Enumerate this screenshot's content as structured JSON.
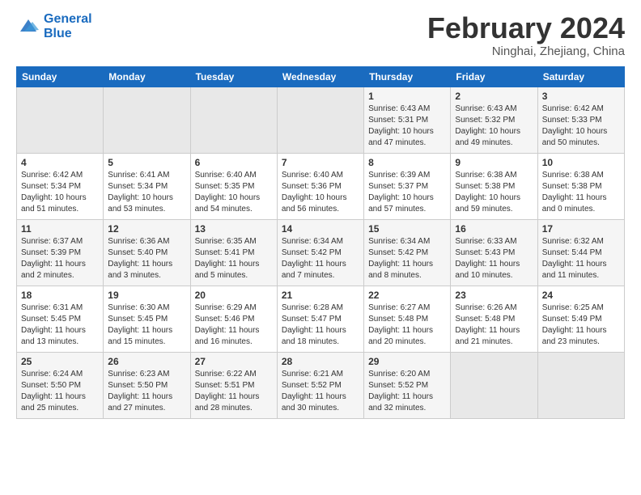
{
  "header": {
    "logo_line1": "General",
    "logo_line2": "Blue",
    "month": "February 2024",
    "location": "Ninghai, Zhejiang, China"
  },
  "weekdays": [
    "Sunday",
    "Monday",
    "Tuesday",
    "Wednesday",
    "Thursday",
    "Friday",
    "Saturday"
  ],
  "weeks": [
    [
      {
        "day": "",
        "info": ""
      },
      {
        "day": "",
        "info": ""
      },
      {
        "day": "",
        "info": ""
      },
      {
        "day": "",
        "info": ""
      },
      {
        "day": "1",
        "info": "Sunrise: 6:43 AM\nSunset: 5:31 PM\nDaylight: 10 hours\nand 47 minutes."
      },
      {
        "day": "2",
        "info": "Sunrise: 6:43 AM\nSunset: 5:32 PM\nDaylight: 10 hours\nand 49 minutes."
      },
      {
        "day": "3",
        "info": "Sunrise: 6:42 AM\nSunset: 5:33 PM\nDaylight: 10 hours\nand 50 minutes."
      }
    ],
    [
      {
        "day": "4",
        "info": "Sunrise: 6:42 AM\nSunset: 5:34 PM\nDaylight: 10 hours\nand 51 minutes."
      },
      {
        "day": "5",
        "info": "Sunrise: 6:41 AM\nSunset: 5:34 PM\nDaylight: 10 hours\nand 53 minutes."
      },
      {
        "day": "6",
        "info": "Sunrise: 6:40 AM\nSunset: 5:35 PM\nDaylight: 10 hours\nand 54 minutes."
      },
      {
        "day": "7",
        "info": "Sunrise: 6:40 AM\nSunset: 5:36 PM\nDaylight: 10 hours\nand 56 minutes."
      },
      {
        "day": "8",
        "info": "Sunrise: 6:39 AM\nSunset: 5:37 PM\nDaylight: 10 hours\nand 57 minutes."
      },
      {
        "day": "9",
        "info": "Sunrise: 6:38 AM\nSunset: 5:38 PM\nDaylight: 10 hours\nand 59 minutes."
      },
      {
        "day": "10",
        "info": "Sunrise: 6:38 AM\nSunset: 5:38 PM\nDaylight: 11 hours\nand 0 minutes."
      }
    ],
    [
      {
        "day": "11",
        "info": "Sunrise: 6:37 AM\nSunset: 5:39 PM\nDaylight: 11 hours\nand 2 minutes."
      },
      {
        "day": "12",
        "info": "Sunrise: 6:36 AM\nSunset: 5:40 PM\nDaylight: 11 hours\nand 3 minutes."
      },
      {
        "day": "13",
        "info": "Sunrise: 6:35 AM\nSunset: 5:41 PM\nDaylight: 11 hours\nand 5 minutes."
      },
      {
        "day": "14",
        "info": "Sunrise: 6:34 AM\nSunset: 5:42 PM\nDaylight: 11 hours\nand 7 minutes."
      },
      {
        "day": "15",
        "info": "Sunrise: 6:34 AM\nSunset: 5:42 PM\nDaylight: 11 hours\nand 8 minutes."
      },
      {
        "day": "16",
        "info": "Sunrise: 6:33 AM\nSunset: 5:43 PM\nDaylight: 11 hours\nand 10 minutes."
      },
      {
        "day": "17",
        "info": "Sunrise: 6:32 AM\nSunset: 5:44 PM\nDaylight: 11 hours\nand 11 minutes."
      }
    ],
    [
      {
        "day": "18",
        "info": "Sunrise: 6:31 AM\nSunset: 5:45 PM\nDaylight: 11 hours\nand 13 minutes."
      },
      {
        "day": "19",
        "info": "Sunrise: 6:30 AM\nSunset: 5:45 PM\nDaylight: 11 hours\nand 15 minutes."
      },
      {
        "day": "20",
        "info": "Sunrise: 6:29 AM\nSunset: 5:46 PM\nDaylight: 11 hours\nand 16 minutes."
      },
      {
        "day": "21",
        "info": "Sunrise: 6:28 AM\nSunset: 5:47 PM\nDaylight: 11 hours\nand 18 minutes."
      },
      {
        "day": "22",
        "info": "Sunrise: 6:27 AM\nSunset: 5:48 PM\nDaylight: 11 hours\nand 20 minutes."
      },
      {
        "day": "23",
        "info": "Sunrise: 6:26 AM\nSunset: 5:48 PM\nDaylight: 11 hours\nand 21 minutes."
      },
      {
        "day": "24",
        "info": "Sunrise: 6:25 AM\nSunset: 5:49 PM\nDaylight: 11 hours\nand 23 minutes."
      }
    ],
    [
      {
        "day": "25",
        "info": "Sunrise: 6:24 AM\nSunset: 5:50 PM\nDaylight: 11 hours\nand 25 minutes."
      },
      {
        "day": "26",
        "info": "Sunrise: 6:23 AM\nSunset: 5:50 PM\nDaylight: 11 hours\nand 27 minutes."
      },
      {
        "day": "27",
        "info": "Sunrise: 6:22 AM\nSunset: 5:51 PM\nDaylight: 11 hours\nand 28 minutes."
      },
      {
        "day": "28",
        "info": "Sunrise: 6:21 AM\nSunset: 5:52 PM\nDaylight: 11 hours\nand 30 minutes."
      },
      {
        "day": "29",
        "info": "Sunrise: 6:20 AM\nSunset: 5:52 PM\nDaylight: 11 hours\nand 32 minutes."
      },
      {
        "day": "",
        "info": ""
      },
      {
        "day": "",
        "info": ""
      }
    ]
  ]
}
